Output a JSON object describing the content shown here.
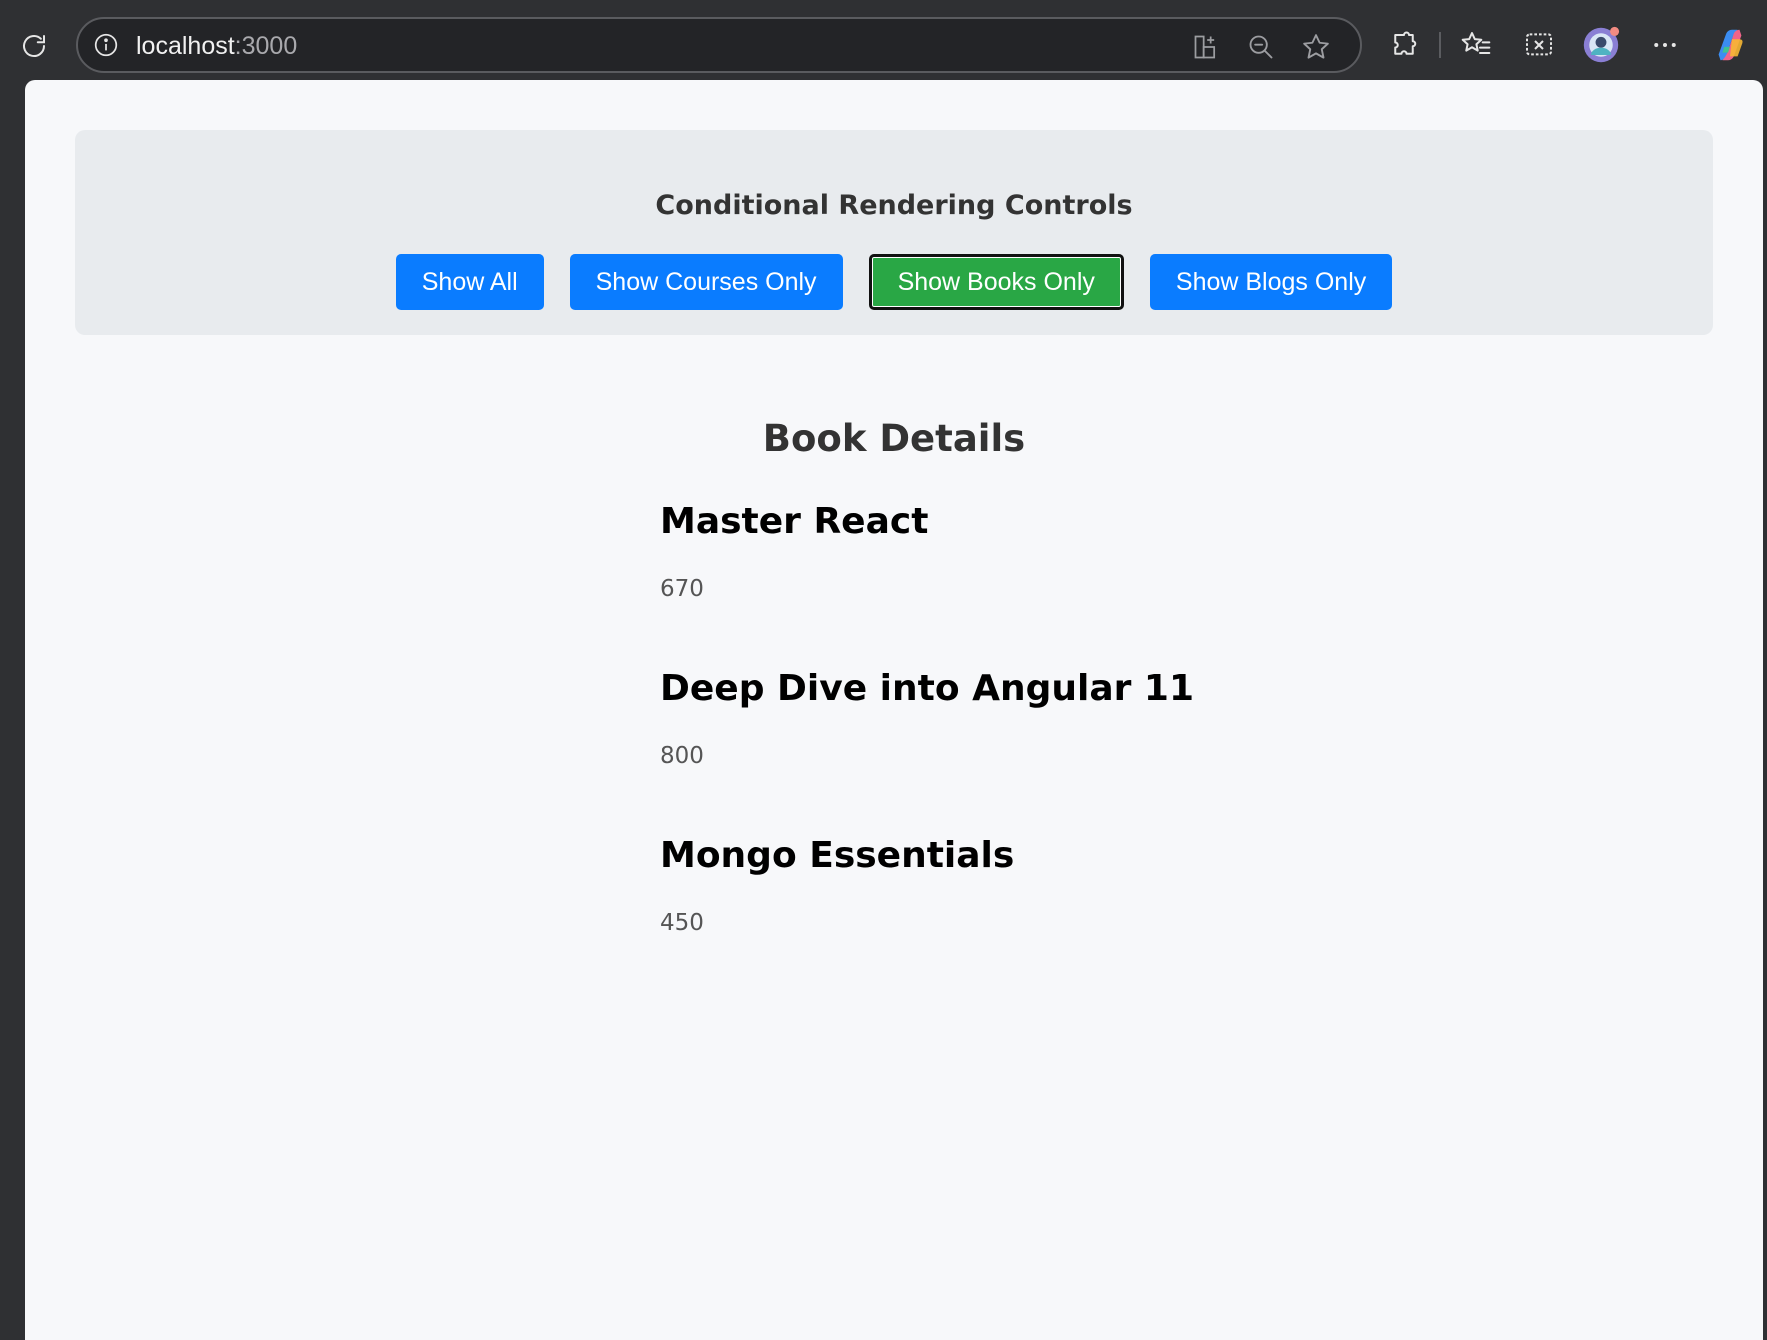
{
  "browser": {
    "url_host": "localhost",
    "url_port": ":3000"
  },
  "controls": {
    "title": "Conditional Rendering Controls",
    "buttons": [
      {
        "label": "Show All",
        "active": false
      },
      {
        "label": "Show Courses Only",
        "active": false
      },
      {
        "label": "Show Books Only",
        "active": true
      },
      {
        "label": "Show Blogs Only",
        "active": false
      }
    ]
  },
  "section": {
    "title": "Book Details"
  },
  "books": [
    {
      "title": "Master React",
      "value": "670"
    },
    {
      "title": "Deep Dive into Angular 11",
      "value": "800"
    },
    {
      "title": "Mongo Essentials",
      "value": "450"
    }
  ],
  "colors": {
    "primary": "#0a7cff",
    "active": "#29a745",
    "panel": "#e8ebee",
    "page_bg": "#f7f8fa",
    "chrome_bg": "#2f3033"
  },
  "icons": {
    "reload": "reload-icon",
    "info": "info-icon",
    "split": "split-screen-icon",
    "zoom": "zoom-out-icon",
    "favorite": "star-icon",
    "extensions": "puzzle-icon",
    "favorites": "favorites-icon",
    "screenshot": "screenshot-icon",
    "profile": "profile-avatar-icon",
    "more": "more-icon",
    "copilot": "copilot-icon"
  }
}
